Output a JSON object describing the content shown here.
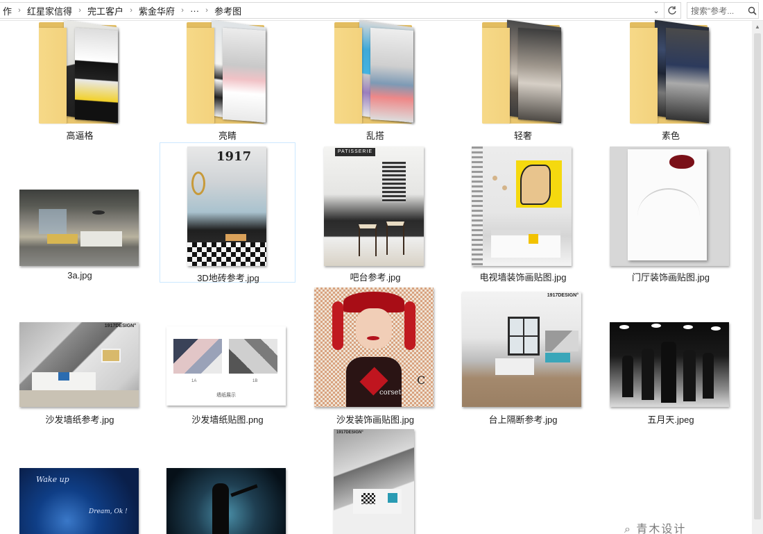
{
  "address": {
    "crumbs": [
      "作",
      "红星家信得",
      "完工客户",
      "紫金华府",
      "···",
      "参考图"
    ],
    "dropdown_glyph": "⌄",
    "refresh_glyph": "↻"
  },
  "search": {
    "placeholder": "搜索\"参考..."
  },
  "folders": [
    {
      "name": "高逼格"
    },
    {
      "name": "亮睛"
    },
    {
      "name": "乱搭"
    },
    {
      "name": "轻奢"
    },
    {
      "name": "素色"
    }
  ],
  "files": [
    {
      "name": "3a.jpg"
    },
    {
      "name": "3D地砖参考.jpg"
    },
    {
      "name": "吧台参考.jpg"
    },
    {
      "name": "电视墙装饰画贴图.jpg"
    },
    {
      "name": "门厅装饰画贴图.jpg"
    },
    {
      "name": "沙发墙纸参考.jpg"
    },
    {
      "name": "沙发墙纸贴图.png"
    },
    {
      "name": "沙发装饰画贴图.jpg"
    },
    {
      "name": "台上隔断参考.jpg"
    },
    {
      "name": "五月天.jpeg"
    }
  ],
  "thumb_text": {
    "tile_1917": "1917",
    "patisserie": "PATISSERIE",
    "design_1917": "1917DESIGN°",
    "corset": "corset",
    "corset_c": "C",
    "wall_caption": "墙纸展示",
    "wall_l": "1A",
    "wall_r": "1B",
    "wakeup": "Wake up",
    "dream": "Dream, Ok !"
  },
  "watermark": "⌕ 青木设计"
}
